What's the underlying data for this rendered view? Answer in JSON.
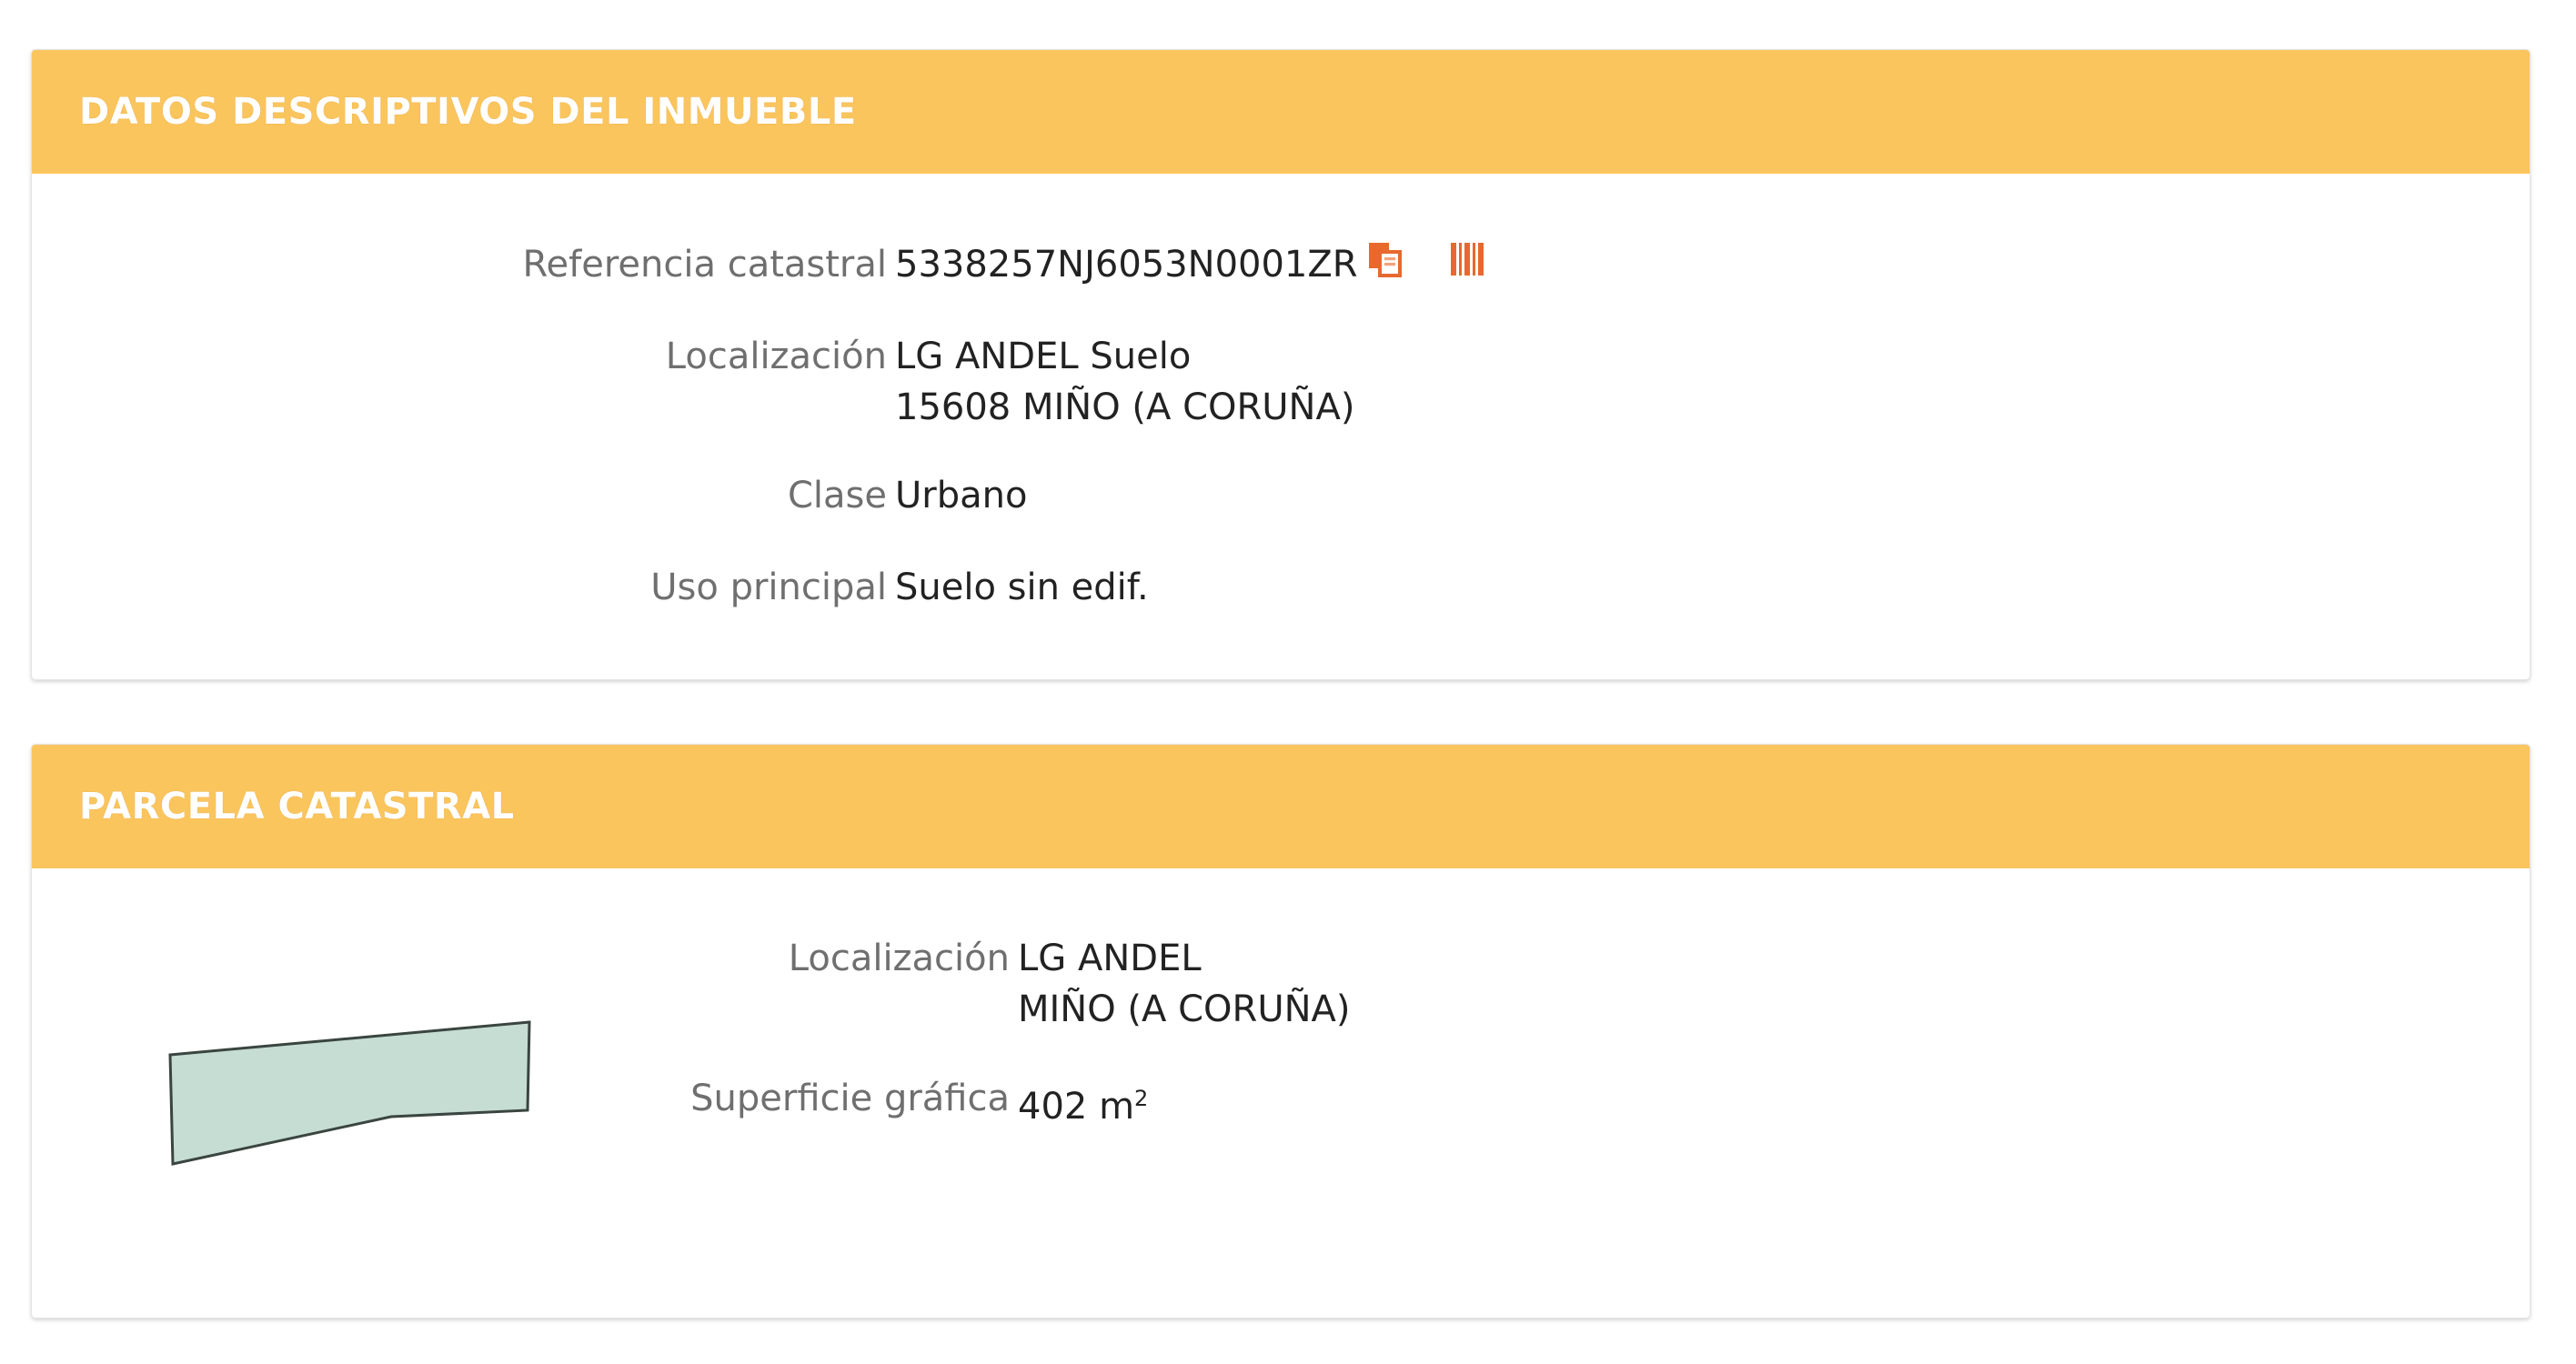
{
  "inmueble": {
    "title": "DATOS DESCRIPTIVOS DEL INMUEBLE",
    "ref_label": "Referencia catastral",
    "ref_value": "5338257NJ6053N0001ZR",
    "loc_label": "Localización",
    "loc_line1": "LG ANDEL Suelo",
    "loc_line2": "15608 MIÑO (A CORUÑA)",
    "clase_label": "Clase",
    "clase_value": "Urbano",
    "uso_label": "Uso principal",
    "uso_value": "Suelo sin edif."
  },
  "parcela": {
    "title": "PARCELA CATASTRAL",
    "loc_label": "Localización",
    "loc_line1": "LG ANDEL",
    "loc_line2": "MIÑO (A CORUÑA)",
    "sup_label": "Superficie gráfica",
    "sup_value": "402 m",
    "sup_unit_exp": "2"
  },
  "icons": {
    "copy": "copy-icon",
    "barcode": "barcode-icon"
  },
  "colors": {
    "header_bg": "#fbc55e",
    "icon_orange": "#e8692e",
    "parcel_fill": "#c6ddd4"
  }
}
